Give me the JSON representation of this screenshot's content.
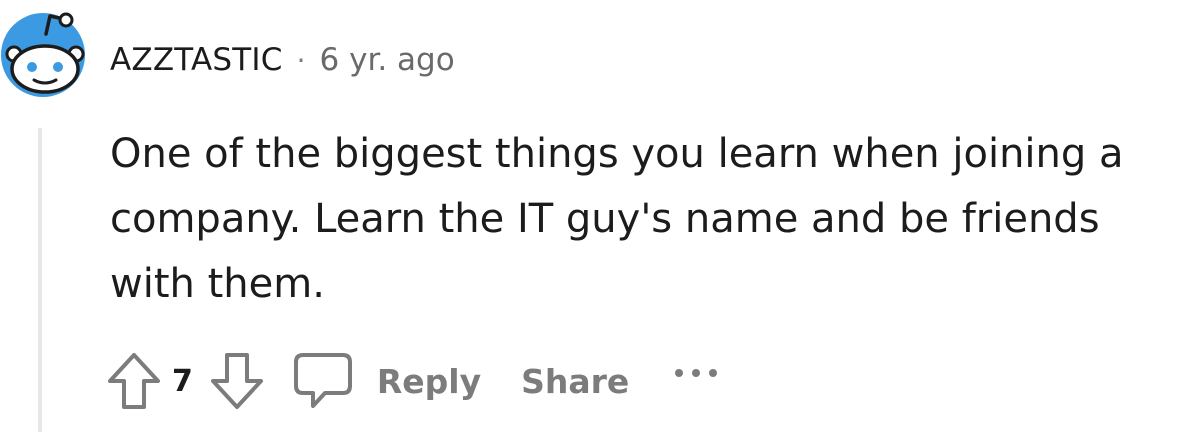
{
  "comment": {
    "author": "AZZTASTIC",
    "separator": "·",
    "time": "6 yr. ago",
    "body": "One of the biggest things you learn when joining a company. Learn the IT guy's name and be friends with them.",
    "score": "7"
  },
  "actions": {
    "reply_label": "Reply",
    "share_label": "Share",
    "more_icon": "more-options-icon"
  },
  "icons": {
    "avatar": "snoo-avatar-icon",
    "upvote": "upvote-arrow-icon",
    "downvote": "downvote-arrow-icon",
    "reply": "speech-bubble-icon"
  },
  "colors": {
    "avatar_bg": "#3b9ae1",
    "icon_gray": "#7c7c7c",
    "thread_line": "#e5e7e9"
  }
}
